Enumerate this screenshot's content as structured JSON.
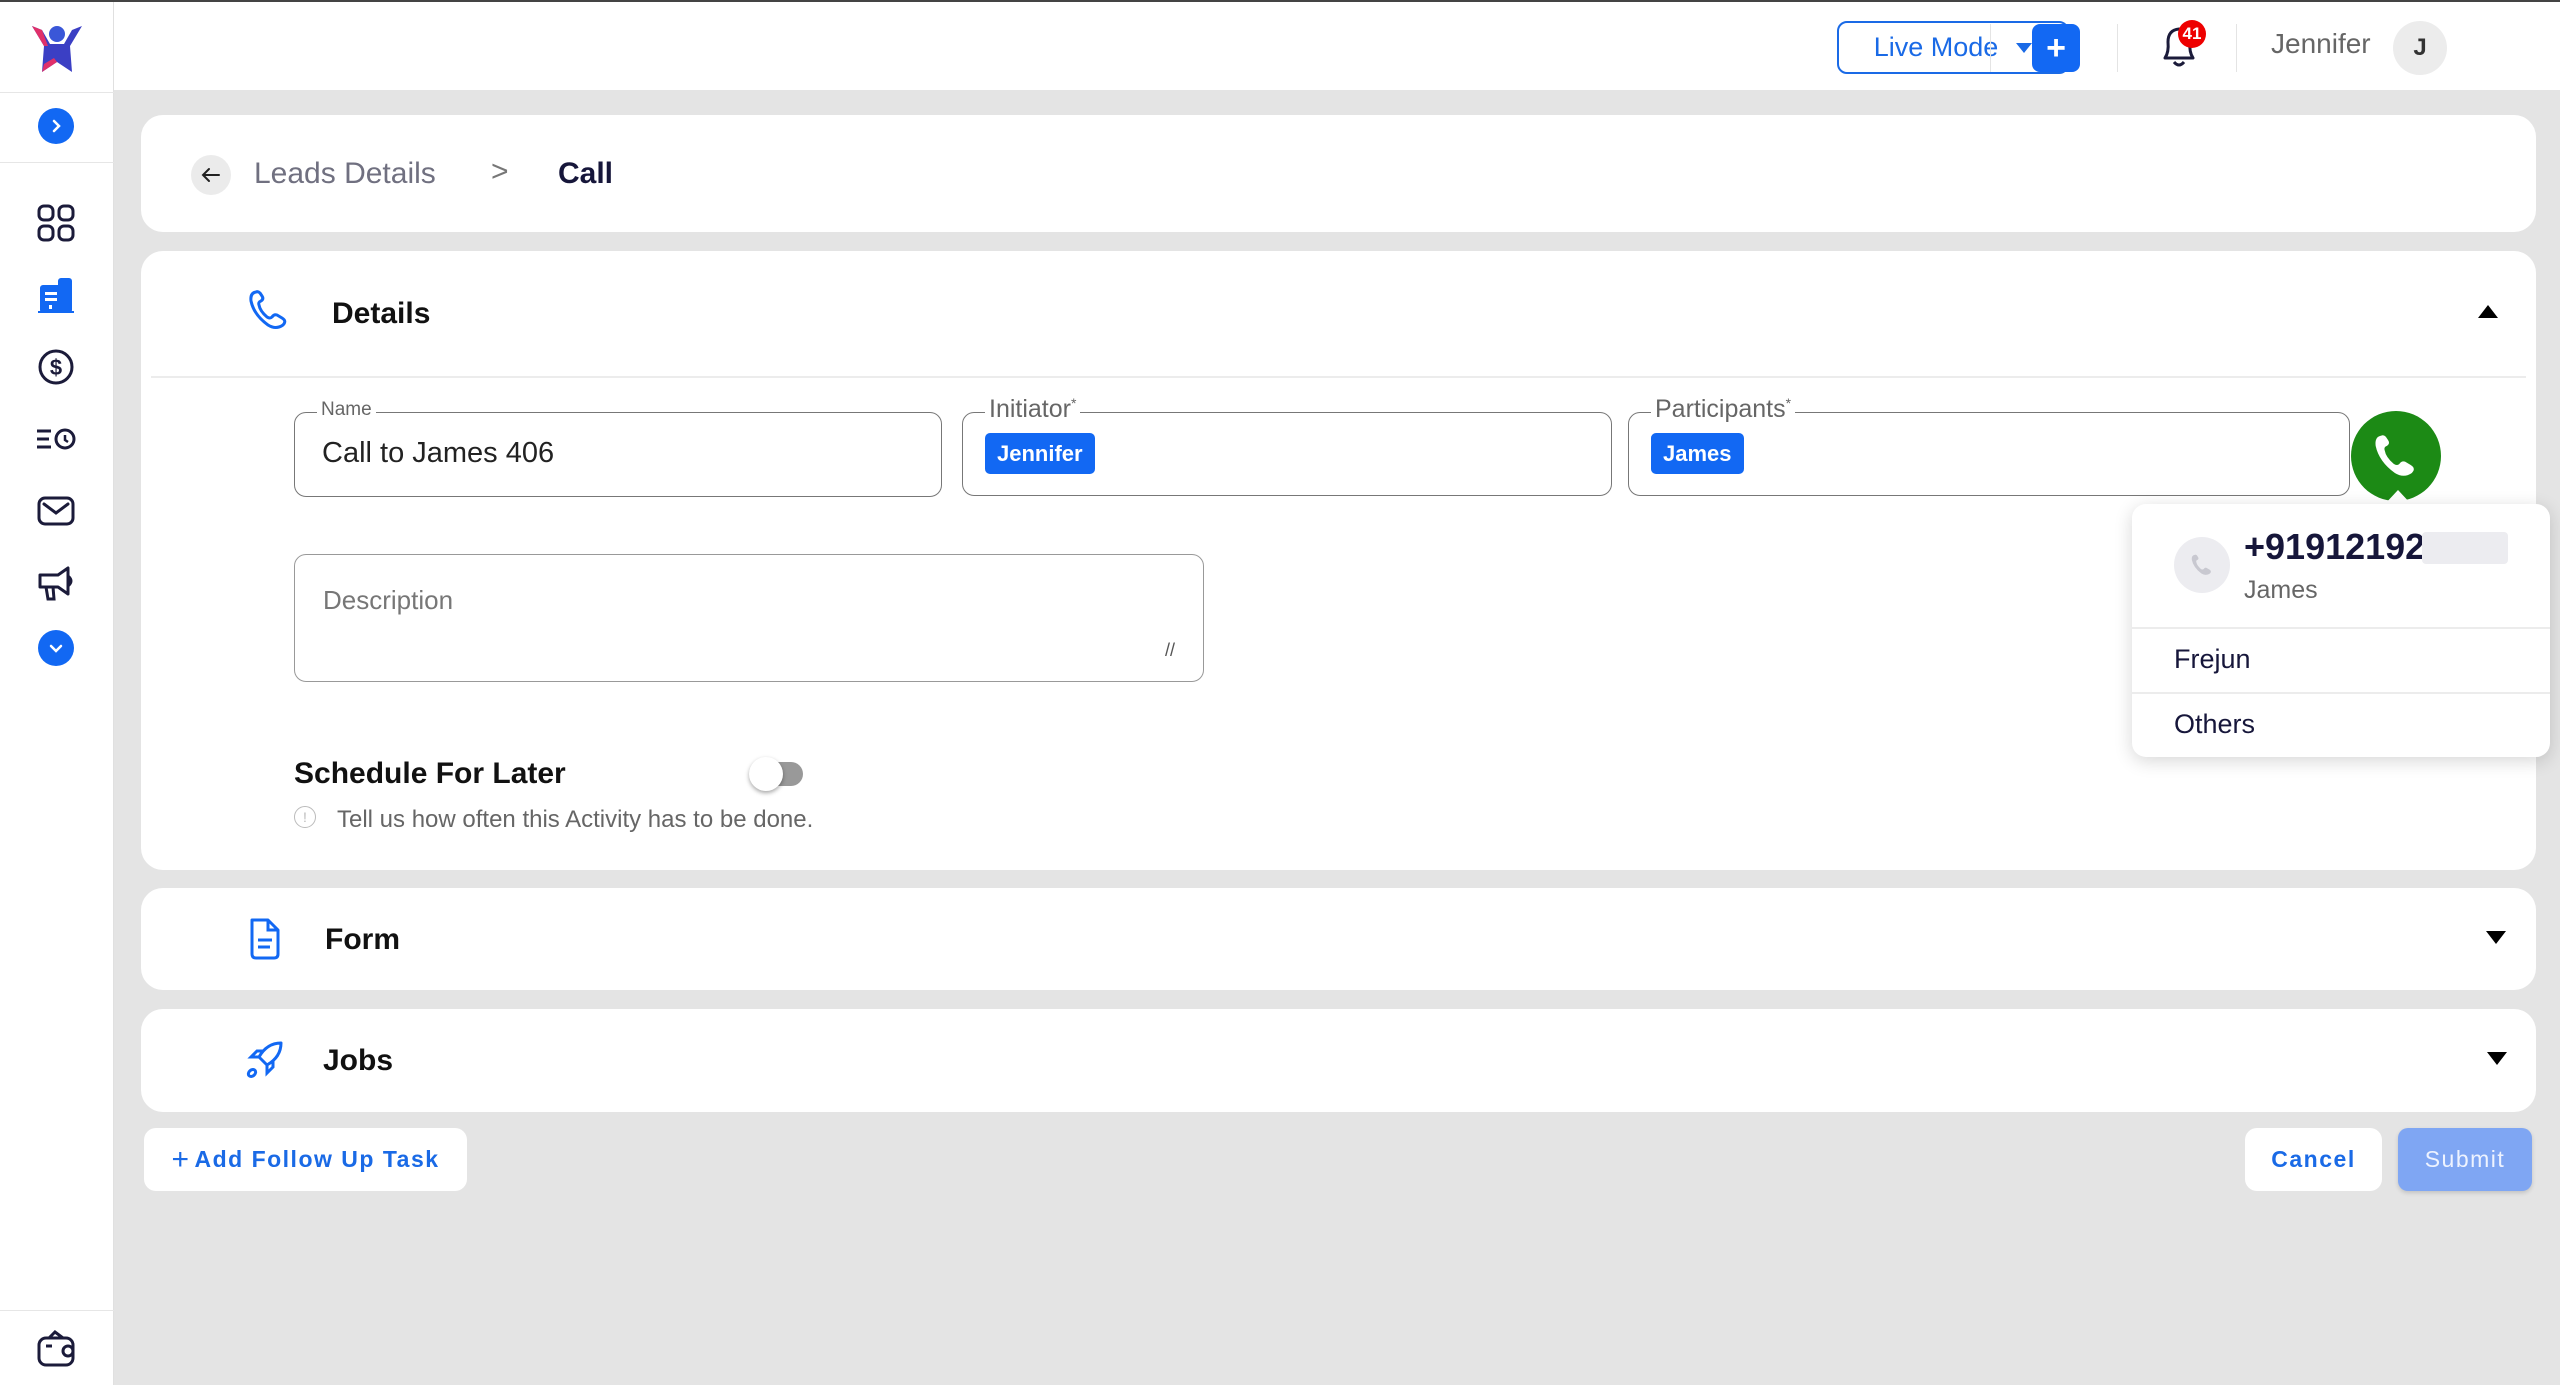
{
  "header": {
    "mode_selector": "Live Mode",
    "add_button": "+",
    "notification_count": "41",
    "user_name": "Jennifer",
    "avatar_initial": "J"
  },
  "sidebar": {
    "items": [
      {
        "icon": "dashboard-grid-icon"
      },
      {
        "icon": "buildings-icon",
        "active": true
      },
      {
        "icon": "dollar-icon"
      },
      {
        "icon": "activity-clock-icon"
      },
      {
        "icon": "mail-icon"
      },
      {
        "icon": "megaphone-icon"
      }
    ],
    "bottom_icon": "wallet-icon"
  },
  "breadcrumb": {
    "parent": "Leads Details",
    "separator": ">",
    "current": "Call"
  },
  "details": {
    "title": "Details",
    "name_label": "Name",
    "name_value": "Call to James  406",
    "initiator_label": "Initiator",
    "initiator_chip": "Jennifer",
    "participants_label": "Participants",
    "participants_chip": "James",
    "required_marker": "*",
    "description_placeholder": "Description",
    "schedule_label": "Schedule For Later",
    "schedule_enabled": false,
    "hint": "Tell us how often this Activity has to be done."
  },
  "call_popover": {
    "number": "+91912192",
    "contact_name": "James",
    "options": [
      "Frejun",
      "Others"
    ]
  },
  "sections": {
    "form": "Form",
    "jobs": "Jobs"
  },
  "actions": {
    "add_followup": "Add Follow Up Task",
    "cancel": "Cancel",
    "submit": "Submit"
  },
  "colors": {
    "accent": "#1268f3",
    "call_green": "#1c8a15",
    "badge_red": "#e00000",
    "submit_disabled": "#7fa6f3"
  }
}
